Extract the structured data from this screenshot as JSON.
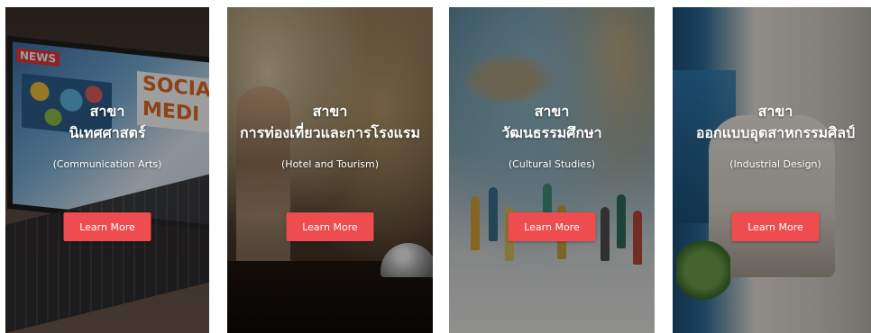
{
  "programs": [
    {
      "title_line1": "สาขา",
      "title_line2": "นิเทศศาสตร์",
      "subtitle": "(Communication Arts)",
      "button_label": "Learn More",
      "screen_badge": "NEWS",
      "screen_heading": "SOCIA MEDI"
    },
    {
      "title_line1": "สาขา",
      "title_line2": "การท่องเที่ยวและการโรงแรม",
      "subtitle": "(Hotel and Tourism)",
      "button_label": "Learn More"
    },
    {
      "title_line1": "สาขา",
      "title_line2": "วัฒนธรรมศึกษา",
      "subtitle": "(Cultural Studies)",
      "button_label": "Learn More"
    },
    {
      "title_line1": "สาขา",
      "title_line2": "ออกแบบอุตสาหกรรมศิลป์",
      "subtitle": "(Industrial Design)",
      "button_label": "Learn More"
    }
  ],
  "colors": {
    "button": "#ee4c4f",
    "text": "#ffffff"
  }
}
